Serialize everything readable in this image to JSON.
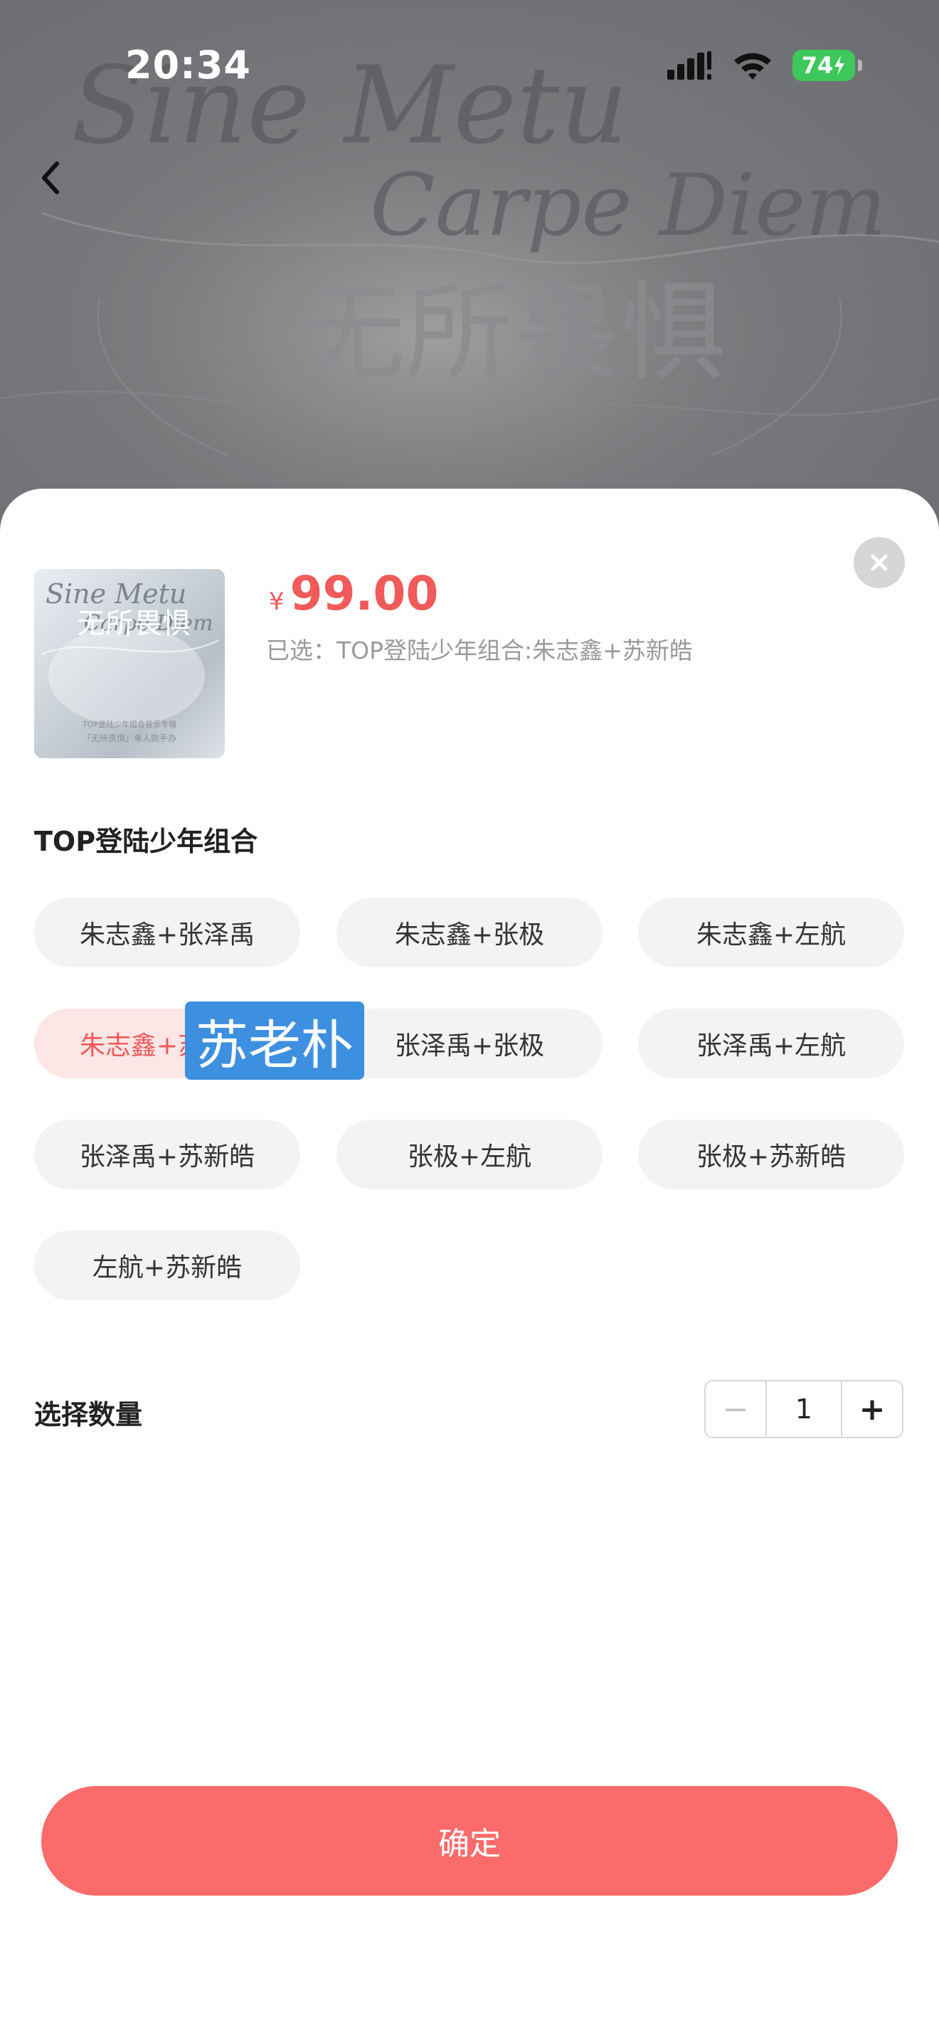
{
  "status_bar": {
    "time": "20:34",
    "battery": "74"
  },
  "background_art": {
    "line1": "Sine Metu",
    "line2": "Carpe Diem",
    "cn_title": "无所畏惧"
  },
  "product": {
    "price_symbol": "¥",
    "price": "99.00",
    "selected_text": "已选：TOP登陆少年组合:朱志鑫+苏新皓",
    "thumb_line1": "Sine Metu",
    "thumb_line2": "Carpe Diem",
    "thumb_cn": "无所畏惧",
    "thumb_caption1": "TOP登陆少年组合音乐专辑",
    "thumb_caption2": "「无所畏惧」单人款手办"
  },
  "options_group": {
    "title": "TOP登陆少年组合",
    "options": [
      {
        "label": "朱志鑫+张泽禹"
      },
      {
        "label": "朱志鑫+张极"
      },
      {
        "label": "朱志鑫+左航"
      },
      {
        "label": "朱志鑫+苏新皓"
      },
      {
        "label": "张泽禹+张极"
      },
      {
        "label": "张泽禹+左航"
      },
      {
        "label": "张泽禹+苏新皓"
      },
      {
        "label": "张极+左航"
      },
      {
        "label": "张极+苏新皓"
      },
      {
        "label": "左航+苏新皓"
      }
    ],
    "selected_index": 3
  },
  "overlay_label": "苏老朴",
  "quantity": {
    "label": "选择数量",
    "value": "1",
    "minus": "−",
    "plus": "+"
  },
  "confirm_label": "确定",
  "colors": {
    "accent": "#f05a5a",
    "button": "#fc6b6b",
    "chip_bg": "#f3f3f3",
    "chip_selected_bg": "#fde6e6",
    "overlay": "#3d8fe0"
  }
}
